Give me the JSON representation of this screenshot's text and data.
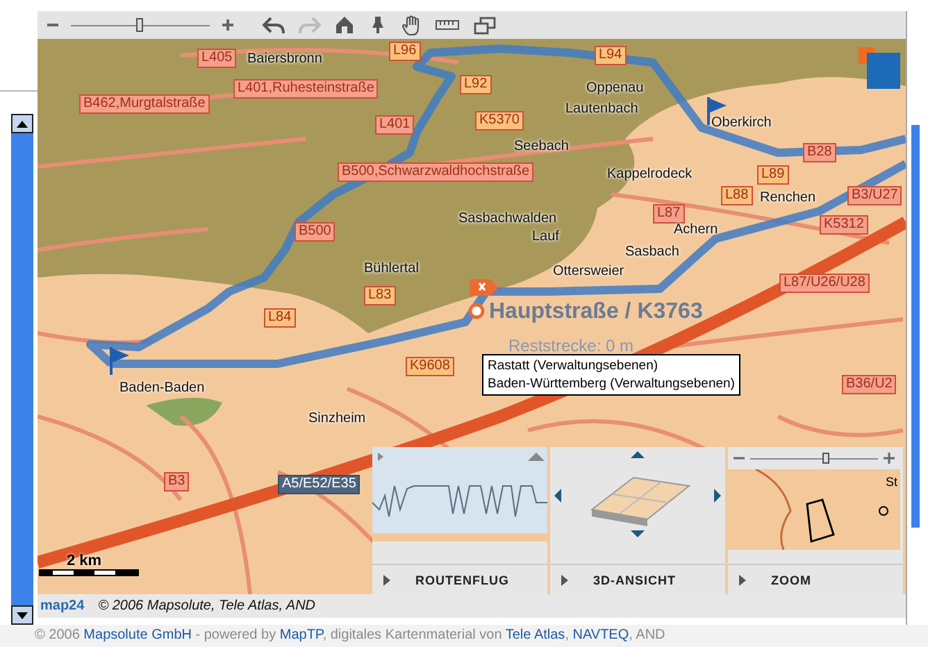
{
  "toolbar": {
    "zoom": {
      "level": 0.5
    },
    "tools": [
      {
        "kind": "back",
        "disabled": false
      },
      {
        "kind": "forward",
        "disabled": true
      },
      {
        "kind": "home",
        "disabled": false
      },
      {
        "kind": "pin",
        "disabled": false
      },
      {
        "kind": "hand",
        "disabled": false
      },
      {
        "kind": "ruler",
        "disabled": false
      },
      {
        "kind": "windows",
        "disabled": false
      }
    ]
  },
  "map": {
    "road_labels": [
      {
        "text": "L405",
        "kind": "road",
        "color": "#f4a08a"
      },
      {
        "text": "L96",
        "kind": "road",
        "color": "#f9c27a"
      },
      {
        "text": "L94",
        "kind": "road",
        "color": "#f9c27a"
      },
      {
        "text": "L92",
        "kind": "road",
        "color": "#f9c27a"
      },
      {
        "text": "L401,Ruhesteinstraße",
        "kind": "road",
        "color": "#f4a08a"
      },
      {
        "text": "B462,Murgtalstraße",
        "kind": "road",
        "color": "#f4a08a"
      },
      {
        "text": "L401",
        "kind": "road",
        "color": "#f4a08a"
      },
      {
        "text": "K5370",
        "kind": "road",
        "color": "#f9c27a"
      },
      {
        "text": "B500,Schwarzwaldhochstraße",
        "kind": "road",
        "color": "#f4a08a"
      },
      {
        "text": "B500",
        "kind": "road",
        "color": "#f4a08a"
      },
      {
        "text": "B28",
        "kind": "road",
        "color": "#f4a08a"
      },
      {
        "text": "L89",
        "kind": "road",
        "color": "#f9c27a"
      },
      {
        "text": "L88",
        "kind": "road",
        "color": "#f9c27a"
      },
      {
        "text": "B3/U27",
        "kind": "road",
        "color": "#f4a08a"
      },
      {
        "text": "L87",
        "kind": "road",
        "color": "#f4a08a"
      },
      {
        "text": "K5312",
        "kind": "road",
        "color": "#f4a08a"
      },
      {
        "text": "L87/U26/U28",
        "kind": "road",
        "color": "#f4a08a"
      },
      {
        "text": "L83",
        "kind": "road",
        "color": "#f9c27a"
      },
      {
        "text": "L84",
        "kind": "road",
        "color": "#f9c27a"
      },
      {
        "text": "K9608",
        "kind": "road",
        "color": "#f9c27a"
      },
      {
        "text": "B36/U2",
        "kind": "road",
        "color": "#f4a08a"
      },
      {
        "text": "B3",
        "kind": "road",
        "color": "#f4a08a"
      },
      {
        "text": "A5/E52/E35",
        "kind": "motorway",
        "color": "#4d6580"
      }
    ],
    "places": [
      "Baiersbronn",
      "Oppenau",
      "Lautenbach",
      "Oberkirch",
      "Seebach",
      "Kappelrodeck",
      "Renchen",
      "Sasbachwalden",
      "Lauf",
      "Achern",
      "Sasbach",
      "Bühlertal",
      "Ottersweier",
      "Sinzheim",
      "Baden-Baden"
    ],
    "destination": {
      "title": "Hauptstraße / K3763",
      "remaining": "Reststrecke: 0 m"
    },
    "tooltip": [
      "Rastatt (Verwaltungsebenen)",
      "Baden-Württemberg (Verwaltungsebenen)"
    ],
    "scale": "2 km",
    "panels": [
      {
        "label": "ROUTENFLUG",
        "kind": "profile"
      },
      {
        "label": "3D-ANSICHT",
        "kind": "view3d"
      },
      {
        "label": "ZOOM",
        "kind": "overview",
        "level": 0.6,
        "place": "St"
      }
    ]
  },
  "attribution": {
    "logo": "map24",
    "text": "© 2006 Mapsolute, Tele Atlas, AND"
  },
  "footer": [
    {
      "text": "© 2006 ",
      "link": false
    },
    {
      "text": "Mapsolute GmbH",
      "link": true
    },
    {
      "text": " - powered by ",
      "link": false
    },
    {
      "text": "MapTP",
      "link": true
    },
    {
      "text": ", digitales Kartenmaterial von ",
      "link": false
    },
    {
      "text": "Tele Atlas",
      "link": true
    },
    {
      "text": ", ",
      "link": false
    },
    {
      "text": "NAVTEQ",
      "link": true
    },
    {
      "text": ", AND",
      "link": false
    }
  ]
}
